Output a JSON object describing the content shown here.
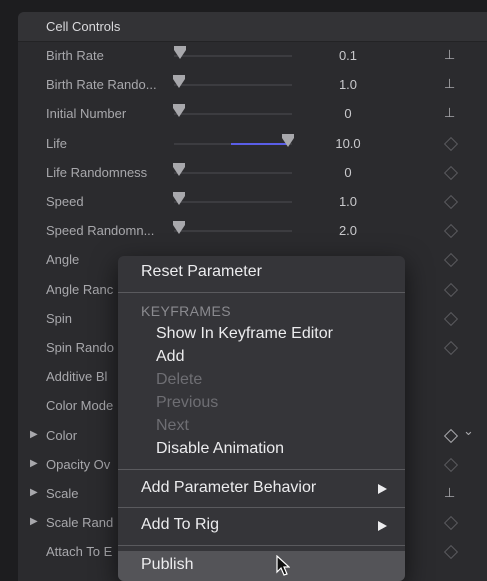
{
  "panel": {
    "title": "Cell Controls"
  },
  "rows": [
    {
      "label": "Birth Rate",
      "value": "0.1",
      "slider": 0.05,
      "fill": false,
      "end": "rig"
    },
    {
      "label": "Birth Rate Rando...",
      "value": "1.0",
      "slider": 0.04,
      "fill": false,
      "end": "rig"
    },
    {
      "label": "Initial Number",
      "value": "0",
      "slider": 0.04,
      "fill": false,
      "end": "rig"
    },
    {
      "label": "Life",
      "value": "10.0",
      "slider": 0.97,
      "fill": true,
      "end": "keyframe"
    },
    {
      "label": "Life Randomness",
      "value": "0",
      "slider": 0.04,
      "fill": false,
      "end": "keyframe"
    },
    {
      "label": "Speed",
      "value": "1.0",
      "slider": 0.04,
      "fill": false,
      "end": "keyframe"
    },
    {
      "label": "Speed Randomn...",
      "value": "2.0",
      "slider": 0.04,
      "fill": false,
      "end": "keyframe"
    },
    {
      "label": "Angle",
      "value": "",
      "end": "keyframe"
    },
    {
      "label": "Angle Ranc",
      "value": "",
      "end": "keyframe"
    },
    {
      "label": "Spin",
      "value": "",
      "end": "keyframe"
    },
    {
      "label": "Spin Rando",
      "value": "",
      "end": "keyframe"
    },
    {
      "label": "Additive Bl",
      "value": "",
      "end": ""
    },
    {
      "label": "Color Mode",
      "value": "",
      "end": ""
    },
    {
      "label": "Color",
      "value": "",
      "end": "keyframe-active",
      "disclosure": true
    },
    {
      "label": "Opacity Ov",
      "value": "",
      "end": "keyframe",
      "disclosure": true
    },
    {
      "label": "Scale",
      "value": "",
      "end": "rig",
      "disclosure": true
    },
    {
      "label": "Scale Rand",
      "value": "",
      "end": "keyframe",
      "disclosure": true
    },
    {
      "label": "Attach To E",
      "value": "",
      "end": "keyframe"
    }
  ],
  "menu": {
    "reset": "Reset Parameter",
    "section_keyframes": "KEYFRAMES",
    "show_in_editor": "Show In Keyframe Editor",
    "add": "Add",
    "delete": "Delete",
    "previous": "Previous",
    "next": "Next",
    "disable_animation": "Disable Animation",
    "add_behavior": "Add Parameter Behavior",
    "add_to_rig": "Add To Rig",
    "publish": "Publish"
  },
  "colors": {
    "accent": "#5a5ee8",
    "menu_bg": "#36363a",
    "highlight": "#545458"
  }
}
